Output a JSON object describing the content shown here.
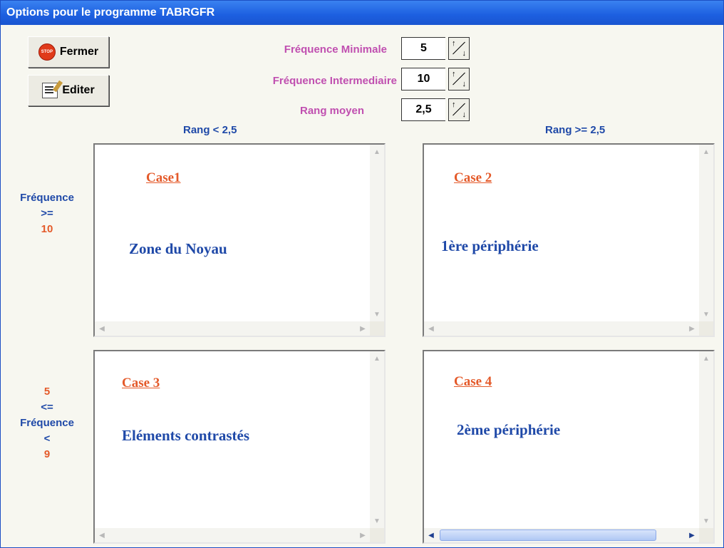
{
  "window": {
    "title": "Options pour le programme TABRGFR"
  },
  "buttons": {
    "fermer": {
      "label": "Fermer",
      "icon": "stop-icon",
      "icon_text": "STOP"
    },
    "editer": {
      "label": "Editer",
      "icon": "edit-icon"
    }
  },
  "params": [
    {
      "label": "Fréquence Minimale",
      "value": "5"
    },
    {
      "label": "Fréquence Intermediaire",
      "value": "10"
    },
    {
      "label": "Rang moyen",
      "value": "2,5"
    }
  ],
  "columns": {
    "left": "Rang < 2,5",
    "right": "Rang >= 2,5"
  },
  "rows": {
    "top": [
      "Fréquence",
      ">=",
      "10"
    ],
    "bottom": [
      "5",
      "<=",
      "Fréquence",
      "<",
      "9"
    ]
  },
  "cases": [
    {
      "title": "Case1",
      "text": "Zone du Noyau"
    },
    {
      "title": "Case 2",
      "text": "1ère périphérie"
    },
    {
      "title": "Case 3",
      "text": "Eléments contrastés"
    },
    {
      "title": "Case 4",
      "text": "2ème périphérie"
    }
  ],
  "colors": {
    "title_bar": "#1c5fe0",
    "param_label": "#c04fb0",
    "case_title": "#e45a2a",
    "case_text": "#1f49a8"
  }
}
